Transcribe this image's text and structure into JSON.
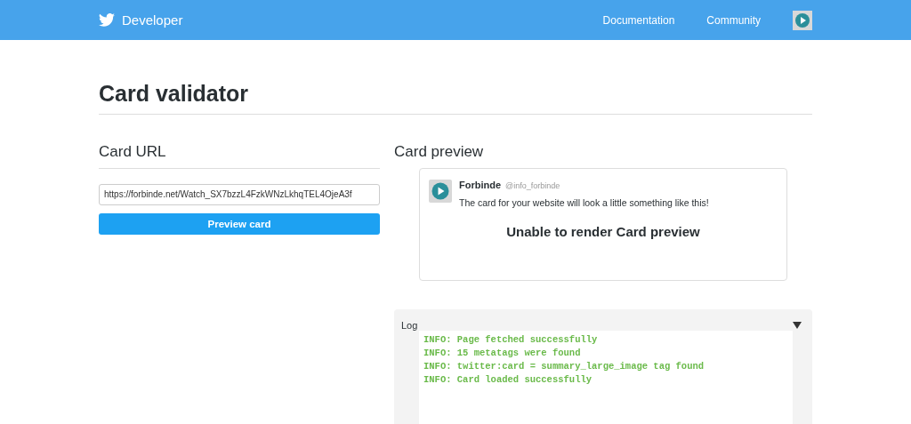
{
  "header": {
    "brand": "Developer",
    "nav": [
      {
        "label": "Documentation"
      },
      {
        "label": "Community"
      }
    ]
  },
  "page_title": "Card validator",
  "card_url": {
    "heading": "Card URL",
    "value": "https://forbinde.net/Watch_SX7bzzL4FzkWNzLkhqTEL4OjeA3f",
    "button": "Preview card"
  },
  "card_preview": {
    "heading": "Card preview",
    "name": "Forbinde",
    "handle": "@info_forbinde",
    "text": "The card for your website will look a little something like this!",
    "message": "Unable to render Card preview"
  },
  "log": {
    "title": "Log",
    "expanded": true,
    "lines": [
      {
        "level": "INFO:",
        "message": "Page fetched successfully"
      },
      {
        "level": "INFO:",
        "message": "15 metatags were found"
      },
      {
        "level": "INFO:",
        "message": "twitter:card = summary_large_image tag found"
      },
      {
        "level": "INFO:",
        "message": "Card loaded successfully"
      }
    ]
  }
}
